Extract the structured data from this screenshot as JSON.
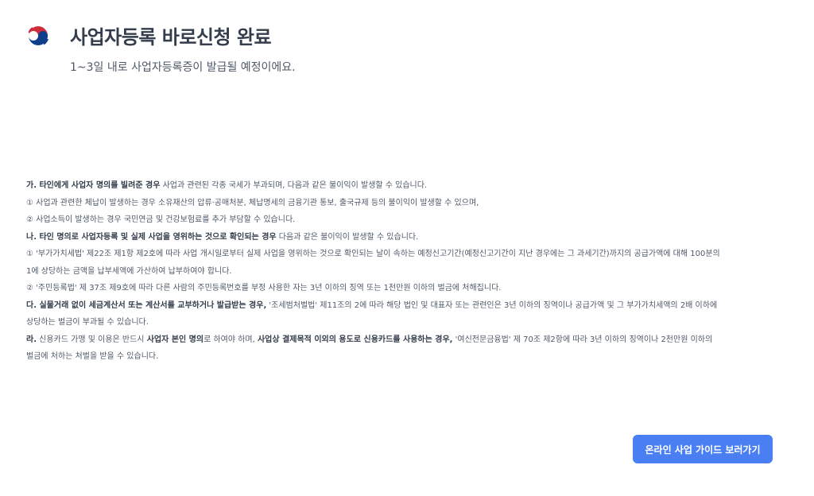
{
  "header": {
    "logo_icon": "taegeuk-emblem-icon",
    "title": "사업자등록 바로신청 완료",
    "subtitle": "1~3일 내로 사업자등록증이 발급될 예정이에요."
  },
  "notice": {
    "ga": {
      "bold": "가. 타인에게 사업자 명의를 빌려준 경우",
      "rest": " 사업과 관련된 각종 국세가 부과되며, 다음과 같은 불이익이 발생할 수 있습니다."
    },
    "ga_1": "① 사업과 관련한 체납이 발생하는 경우 소유재산의 압류·공매처분, 체납명세의 금융기관 통보, 출국규제 등의 불이익이 발생할 수 있으며,",
    "ga_2": "② 사업소득이 발생하는 경우 국민연금 및 건강보험료를 추가 부담할 수 있습니다.",
    "na": {
      "bold": "나. 타인 명의로 사업자등록 및 실제 사업을 영위하는 것으로 확인되는 경우",
      "rest": " 다음과 같은 불이익이 발생할 수 있습니다."
    },
    "na_1a": "① '부가가치세법' 제22조 제1항 제2호에 따라 사업 개시일로부터 실제 사업을 영위하는 것으로 확인되는 날이 속하는 예정신고기간(예정신고기간이 지난 경우에는 그 과세기간)까지의 공급가액에 대해 100분의",
    "na_1b": "1에 상당하는 금액을 납부세액에 가산하여 납부하여야 합니다.",
    "na_2": "② '주민등록법' 제 37조 제9호에 따라 다른 사람의 주민등록번호를 부정 사용한 자는 3년 이하의 징역 또는 1천만원 이하의 벌금에 처해집니다.",
    "da": {
      "bold": "다. 실물거래 없이 세금계산서 또는 계산서를 교부하거나 발급받는 경우,",
      "rest": " '조세범처벌법' 제11조의 2에 따라 해당 법인 및 대표자 또는 관련인은 3년 이하의 징역이나 공급가액 및 그 부가가치세액의 2배 이하에",
      "cont": "상당하는 벌금이 부과될 수 있습니다."
    },
    "ra": {
      "bold1": "라.",
      "text1": " 신용카드 가맹 및 이용은 반드시 ",
      "bold2": "사업자 본인 명의",
      "text2": "로 하여야 하며, ",
      "bold3": "사업상 결제목적 이외의 용도로 신용카드를 사용하는 경우,",
      "text3": " '여신전문금융법' 제 70조 제2항에 따라 3년 이하의 징역이나 2천만원 이하의",
      "cont": "벌금에 처하는 처벌을 받을 수 있습니다."
    }
  },
  "actions": {
    "guide_label": "온라인 사업 가이드 보러가기"
  },
  "colors": {
    "accent": "#4a7ff3",
    "title": "#333d4b",
    "body": "#4e5968",
    "emblem_red": "#cd2e3a",
    "emblem_blue": "#0f3f8c"
  }
}
